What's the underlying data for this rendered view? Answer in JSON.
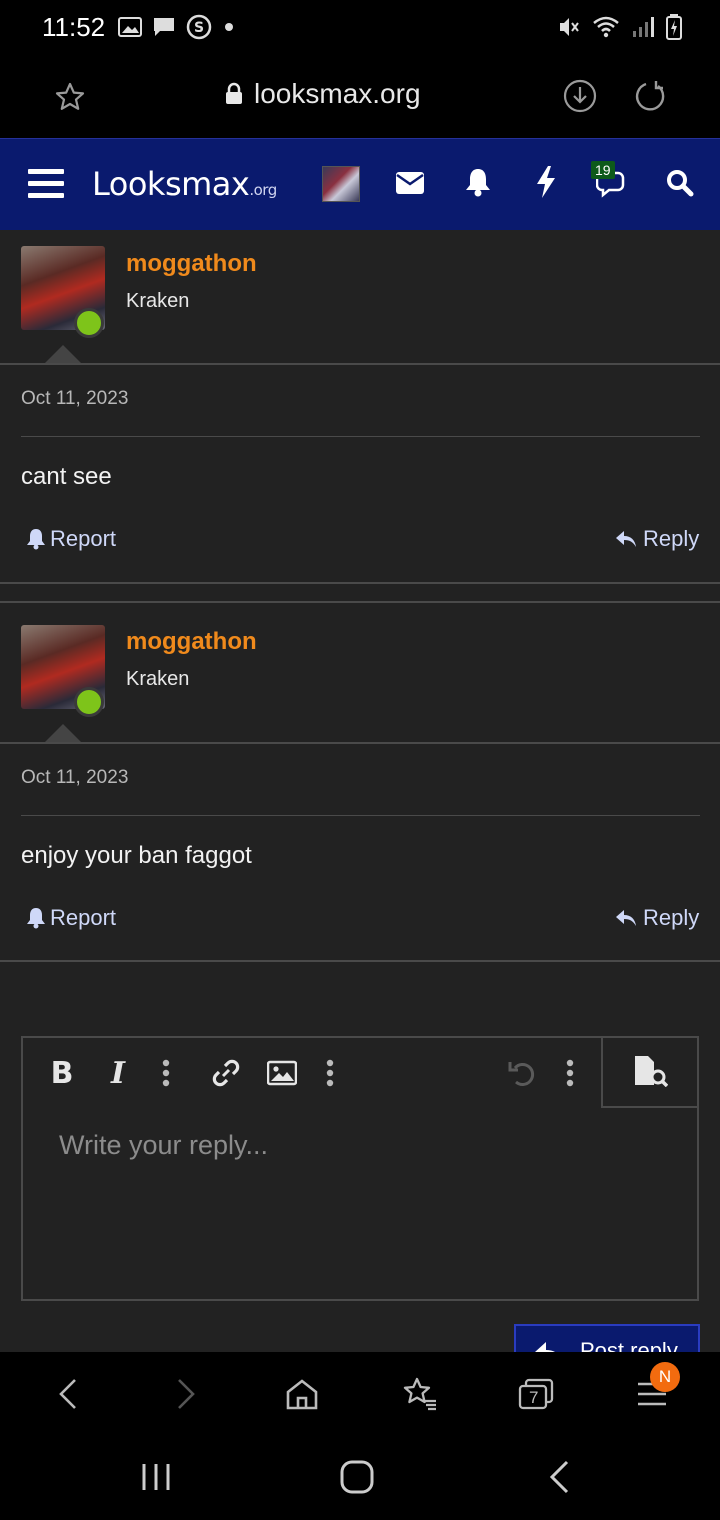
{
  "status_bar": {
    "time": "11:52",
    "left_icons": [
      "image-icon",
      "chat-icon",
      "s-icon",
      "dot-icon"
    ],
    "right_icons": [
      "mute-icon",
      "wifi-icon",
      "signal-icon",
      "battery-icon"
    ]
  },
  "browser": {
    "url": "looksmax.org",
    "left_icon": "star-icon",
    "right_icons": [
      "download-icon",
      "reload-icon"
    ]
  },
  "site_header": {
    "logo_main": "Looksmax",
    "logo_suffix": ".org",
    "conversations_badge": "19",
    "icons": [
      "menu-icon",
      "avatar",
      "mail-icon",
      "bell-icon",
      "bolt-icon",
      "chat-icon",
      "search-icon"
    ]
  },
  "posts": [
    {
      "username": "moggathon",
      "user_title": "Kraken",
      "date": "Oct 11, 2023",
      "message": "cant see",
      "report_label": "Report",
      "reply_label": "Reply"
    },
    {
      "username": "moggathon",
      "user_title": "Kraken",
      "date": "Oct 11, 2023",
      "message": "enjoy your ban faggot",
      "report_label": "Report",
      "reply_label": "Reply"
    }
  ],
  "editor": {
    "placeholder": "Write your reply...",
    "toolbar": [
      "bold-icon",
      "italic-icon",
      "more-icon",
      "link-icon",
      "image-icon",
      "more-icon",
      "undo-icon",
      "more-icon",
      "preview-icon"
    ],
    "bold_glyph": "B",
    "italic_glyph": "I",
    "post_reply_label": "Post reply"
  },
  "bottom_nav": {
    "icons": [
      "back-icon",
      "forward-icon",
      "home-icon",
      "bookmarks-icon",
      "tabs-icon",
      "menu-icon"
    ],
    "tabs_count": "7",
    "menu_badge": "N"
  },
  "system_nav": {
    "icons": [
      "recents-icon",
      "home-icon",
      "back-icon"
    ]
  }
}
